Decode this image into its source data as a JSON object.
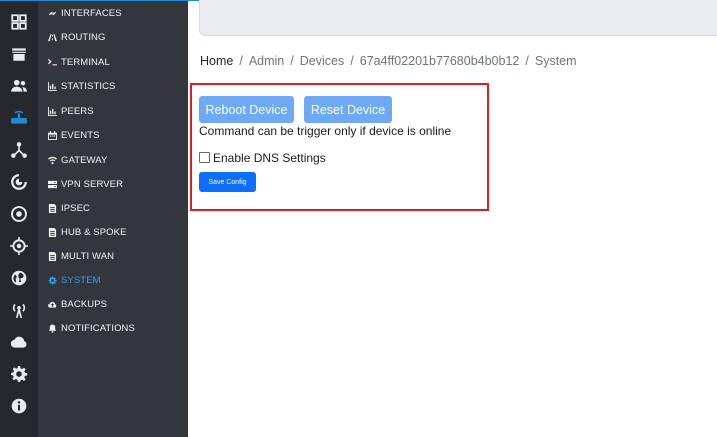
{
  "rail": {
    "icons": [
      "grid-icon",
      "store-icon",
      "users-icon",
      "router-icon",
      "network-icon",
      "radar-icon",
      "target-icon",
      "crosshair-icon",
      "globe-icon",
      "antenna-icon",
      "cloud-icon",
      "gear-icon",
      "info-icon"
    ]
  },
  "menu": {
    "items": [
      {
        "label": "INTERFACES",
        "icon": "link-icon"
      },
      {
        "label": "ROUTING",
        "icon": "road-icon"
      },
      {
        "label": "TERMINAL",
        "icon": "terminal-icon"
      },
      {
        "label": "STATISTICS",
        "icon": "bar-chart-icon"
      },
      {
        "label": "PEERS",
        "icon": "bar-chart-icon"
      },
      {
        "label": "EVENTS",
        "icon": "calendar-icon"
      },
      {
        "label": "GATEWAY",
        "icon": "wifi-icon"
      },
      {
        "label": "VPN SERVER",
        "icon": "server-icon"
      },
      {
        "label": "IPSEC",
        "icon": "document-icon"
      },
      {
        "label": "HUB & SPOKE",
        "icon": "document-icon"
      },
      {
        "label": "MULTI WAN",
        "icon": "document-icon"
      },
      {
        "label": "SYSTEM",
        "icon": "gear-icon"
      },
      {
        "label": "BACKUPS",
        "icon": "cloud-upload-icon"
      },
      {
        "label": "NOTIFICATIONS",
        "icon": "bell-icon"
      }
    ],
    "active": "SYSTEM"
  },
  "breadcrumb": {
    "home": "Home",
    "separator": "/",
    "admin": "Admin",
    "devices": "Devices",
    "device_id": "67a4ff02201b77680b4b0b12",
    "current": "System"
  },
  "actions": {
    "reboot_label": "Reboot Device",
    "reset_label": "Reset Device",
    "note": "Command can be trigger only if device is online"
  },
  "dns": {
    "label": "Enable DNS Settings",
    "checked": false
  },
  "save_label": "Save Config",
  "colors": {
    "accent": "#29a3ea",
    "button_light": "#6da9f5",
    "button_primary": "#0d6efd",
    "highlight_border": "#e01d25"
  }
}
